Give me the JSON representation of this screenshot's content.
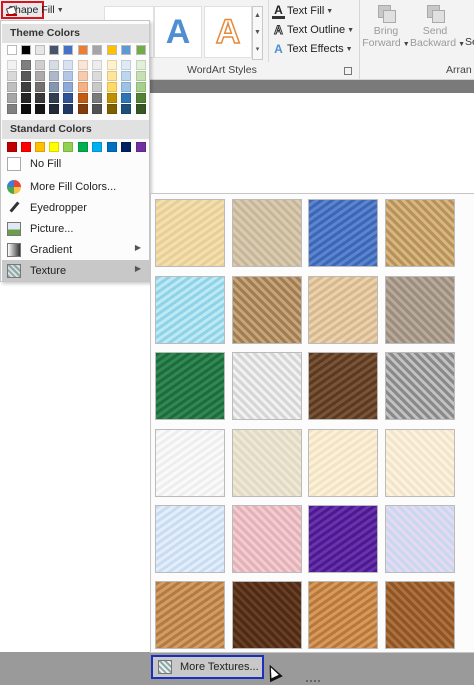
{
  "ribbon": {
    "shape_fill_label": "Shape Fill",
    "wordart_letter": "A",
    "text_fill_label": "Text Fill",
    "text_outline_label": "Text Outline",
    "text_effects_label": "Text Effects",
    "wordart_group_label": "WordArt Styles",
    "arrange_group_label": "Arran",
    "bring_forward_label": "Bring",
    "bring_forward_label2": "Forward",
    "send_backward_label": "Send",
    "send_backward_label2": "Backward",
    "selection_partial": "Se"
  },
  "menu": {
    "theme_colors_header": "Theme Colors",
    "standard_colors_header": "Standard Colors",
    "items": {
      "no_fill": "No Fill",
      "more_fill_colors": "More Fill Colors...",
      "eyedropper": "Eyedropper",
      "picture": "Picture...",
      "gradient": "Gradient",
      "texture": "Texture"
    },
    "more_textures": "More Textures..."
  },
  "colors": {
    "theme_top": [
      "#ffffff",
      "#000000",
      "#e7e6e6",
      "#44546a",
      "#4472c4",
      "#ed7d31",
      "#a5a5a5",
      "#ffc000",
      "#5b9bd5",
      "#70ad47"
    ],
    "theme_shades": [
      [
        "#f2f2f2",
        "#d9d9d9",
        "#bfbfbf",
        "#a6a6a6",
        "#808080"
      ],
      [
        "#7f7f7f",
        "#595959",
        "#404040",
        "#262626",
        "#0d0d0d"
      ],
      [
        "#d0cece",
        "#aeaaaa",
        "#757171",
        "#3a3838",
        "#171616"
      ],
      [
        "#d6dce4",
        "#adb9ca",
        "#8497b0",
        "#333f4f",
        "#222a35"
      ],
      [
        "#d9e2f3",
        "#b4c6e7",
        "#8eaadb",
        "#2f5496",
        "#1f3864"
      ],
      [
        "#fbe5d5",
        "#f7cbac",
        "#f4b183",
        "#c55a11",
        "#833c0b"
      ],
      [
        "#ededed",
        "#dbdbdb",
        "#c9c9c9",
        "#7b7b7b",
        "#525252"
      ],
      [
        "#fff2cc",
        "#fee599",
        "#ffd965",
        "#bf9000",
        "#7f6000"
      ],
      [
        "#deebf6",
        "#bdd7ee",
        "#9cc3e5",
        "#2e75b5",
        "#1f4e79"
      ],
      [
        "#e2efd9",
        "#c5e0b3",
        "#a8d08d",
        "#538135",
        "#375623"
      ]
    ],
    "standard": [
      "#c00000",
      "#ff0000",
      "#ffc000",
      "#ffff00",
      "#92d050",
      "#00b050",
      "#00b0f0",
      "#0070c0",
      "#002060",
      "#7030a0"
    ]
  },
  "textures": [
    {
      "name": "Papyrus",
      "c1": "#e8cf96",
      "c2": "#f3dfb0"
    },
    {
      "name": "Canvas",
      "c1": "#d9cbb1",
      "c2": "#c7b696"
    },
    {
      "name": "Denim",
      "c1": "#3d67b6",
      "c2": "#5b86cf"
    },
    {
      "name": "Woven mat",
      "c1": "#b8925a",
      "c2": "#d7b882"
    },
    {
      "name": "Water droplets",
      "c1": "#8fd3e8",
      "c2": "#bde8f4"
    },
    {
      "name": "Paper bag",
      "c1": "#a17d55",
      "c2": "#c9a57a"
    },
    {
      "name": "Fish fossil",
      "c1": "#d8b88c",
      "c2": "#e9d2ad"
    },
    {
      "name": "Sand",
      "c1": "#9c8d7e",
      "c2": "#b9ab9c"
    },
    {
      "name": "Green marble",
      "c1": "#1f6b3d",
      "c2": "#2e8a52"
    },
    {
      "name": "White marble",
      "c1": "#d6d6d6",
      "c2": "#f2f2f2"
    },
    {
      "name": "Brown marble",
      "c1": "#5a3a22",
      "c2": "#7b5436"
    },
    {
      "name": "Granite",
      "c1": "#8a8a8a",
      "c2": "#c2c2c2"
    },
    {
      "name": "Newsprint",
      "c1": "#eeeeee",
      "c2": "#fafafa"
    },
    {
      "name": "Recycled paper",
      "c1": "#e3dac4",
      "c2": "#efe8d6"
    },
    {
      "name": "Parchment",
      "c1": "#f3e3c3",
      "c2": "#fbf0da"
    },
    {
      "name": "Stationery",
      "c1": "#f4e5c8",
      "c2": "#fbf3e2"
    },
    {
      "name": "Blue tissue paper",
      "c1": "#c9dcf1",
      "c2": "#e4eefa"
    },
    {
      "name": "Pink tissue paper",
      "c1": "#e5b1b8",
      "c2": "#f1cdd2"
    },
    {
      "name": "Purple mesh",
      "c1": "#4b1a8c",
      "c2": "#6a32b0"
    },
    {
      "name": "Bouquet",
      "c1": "#c7d9f0",
      "c2": "#e8d8f0"
    },
    {
      "name": "Cork",
      "c1": "#b27a44",
      "c2": "#d39d62"
    },
    {
      "name": "Walnut",
      "c1": "#4d2b17",
      "c2": "#6b3f24"
    },
    {
      "name": "Oak",
      "c1": "#b9773b",
      "c2": "#d69a5c"
    },
    {
      "name": "Medium wood",
      "c1": "#8e5526",
      "c2": "#b07140"
    }
  ]
}
